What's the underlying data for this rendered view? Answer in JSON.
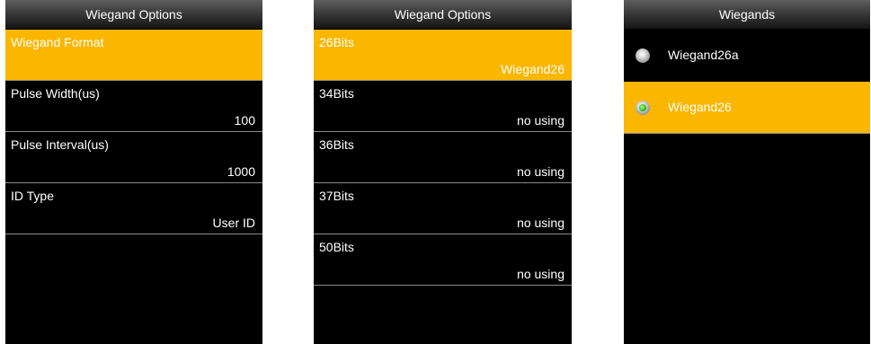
{
  "screen1": {
    "title": "Wiegand Options",
    "items": [
      {
        "label": "Wiegand Format",
        "value": ""
      },
      {
        "label": "Pulse Width(us)",
        "value": "100"
      },
      {
        "label": "Pulse Interval(us)",
        "value": "1000"
      },
      {
        "label": "ID Type",
        "value": "User ID"
      }
    ]
  },
  "screen2": {
    "title": "Wiegand Options",
    "items": [
      {
        "label": "26Bits",
        "value": "Wiegand26"
      },
      {
        "label": "34Bits",
        "value": "no using"
      },
      {
        "label": "36Bits",
        "value": "no using"
      },
      {
        "label": "37Bits",
        "value": "no using"
      },
      {
        "label": "50Bits",
        "value": "no using"
      }
    ]
  },
  "screen3": {
    "title": "Wiegands",
    "options": [
      {
        "label": "Wiegand26a",
        "selected": false
      },
      {
        "label": "Wiegand26",
        "selected": true
      }
    ]
  },
  "colors": {
    "highlight": "#fbb600",
    "background": "#000000",
    "text": "#ffffff",
    "radio_selected": "#32c21a"
  }
}
